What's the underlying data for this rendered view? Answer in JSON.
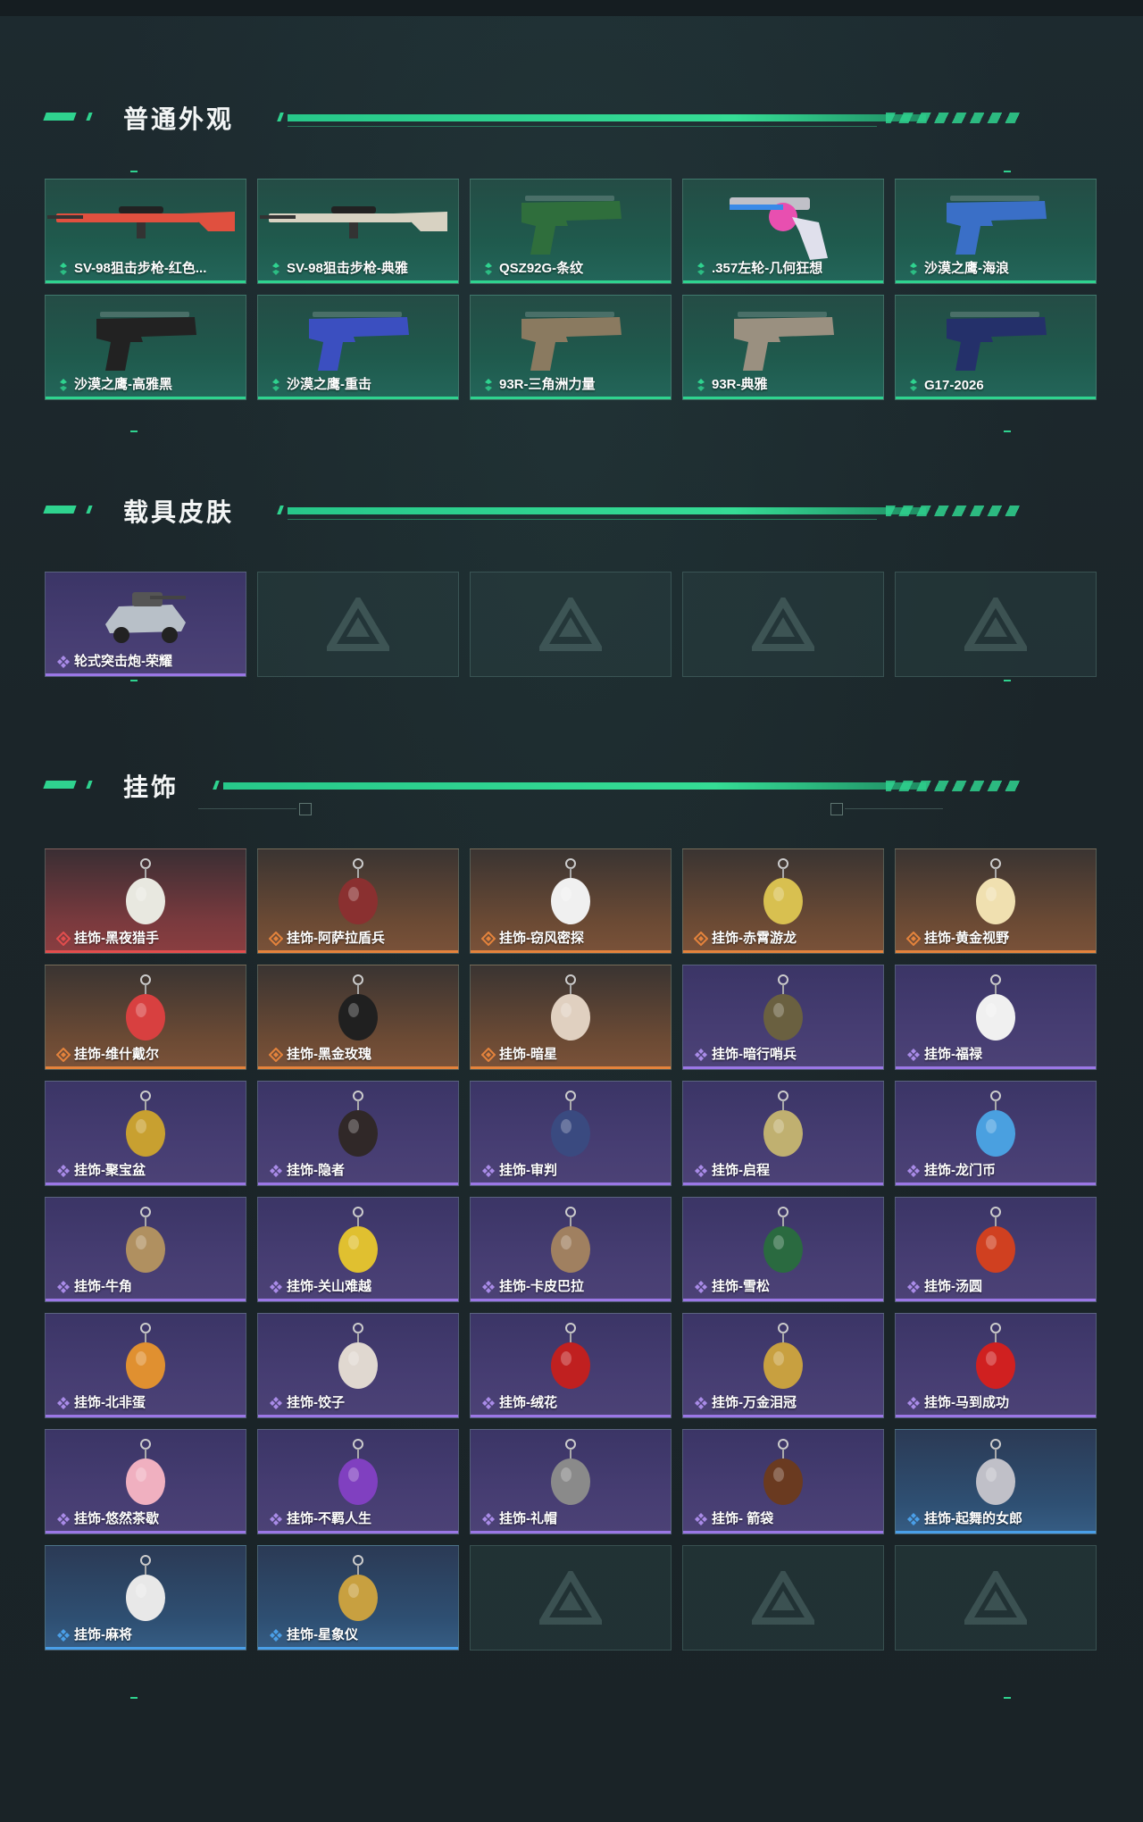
{
  "sections": {
    "skins": {
      "title": "普通外观",
      "items": [
        {
          "label": "SV-98狙击步枪-红色...",
          "rarity": "green",
          "icon": "sniper-rifle-icon",
          "color": "#e0503f"
        },
        {
          "label": "SV-98狙击步枪-典雅",
          "rarity": "green",
          "icon": "sniper-rifle-icon",
          "color": "#d8d2c2"
        },
        {
          "label": "QSZ92G-条纹",
          "rarity": "green",
          "icon": "pistol-icon",
          "color": "#2f6e3c"
        },
        {
          "label": ".357左轮-几何狂想",
          "rarity": "green",
          "icon": "revolver-icon",
          "color": "#e84fb0"
        },
        {
          "label": "沙漠之鹰-海浪",
          "rarity": "green",
          "icon": "pistol-icon",
          "color": "#3a6fc7"
        },
        {
          "label": "沙漠之鹰-高雅黑",
          "rarity": "green",
          "icon": "pistol-icon",
          "color": "#222222"
        },
        {
          "label": "沙漠之鹰-重击",
          "rarity": "green",
          "icon": "pistol-icon",
          "color": "#3b4fc0"
        },
        {
          "label": "93R-三角洲力量",
          "rarity": "green",
          "icon": "pistol-icon",
          "color": "#8a7a60"
        },
        {
          "label": "93R-典雅",
          "rarity": "green",
          "icon": "pistol-icon",
          "color": "#9a9080"
        },
        {
          "label": "G17-2026",
          "rarity": "green",
          "icon": "pistol-icon",
          "color": "#24306a"
        }
      ]
    },
    "vehicles": {
      "title": "载具皮肤",
      "items": [
        {
          "label": "轮式突击炮-荣耀",
          "rarity": "purple",
          "icon": "vehicle-icon",
          "color": "#b8c0c8"
        }
      ]
    },
    "charms": {
      "title": "挂饰",
      "items": [
        {
          "label": "挂饰-黑夜猎手",
          "rarity": "red",
          "icon": "charm-icon",
          "color": "#e8e8e0"
        },
        {
          "label": "挂饰-阿萨拉盾兵",
          "rarity": "orange",
          "icon": "charm-icon",
          "color": "#8a3030"
        },
        {
          "label": "挂饰-窃风密探",
          "rarity": "orange",
          "icon": "charm-icon",
          "color": "#f0f0f0"
        },
        {
          "label": "挂饰-赤霄游龙",
          "rarity": "orange",
          "icon": "charm-icon",
          "color": "#d8c050"
        },
        {
          "label": "挂饰-黄金视野",
          "rarity": "orange",
          "icon": "charm-icon",
          "color": "#f0e0b0"
        },
        {
          "label": "挂饰-维什戴尔",
          "rarity": "orange",
          "icon": "charm-icon",
          "color": "#d84040"
        },
        {
          "label": "挂饰-黑金玫瑰",
          "rarity": "orange",
          "icon": "charm-icon",
          "color": "#202020"
        },
        {
          "label": "挂饰-暗星",
          "rarity": "orange",
          "icon": "charm-icon",
          "color": "#e0d0c0"
        },
        {
          "label": "挂饰-暗行哨兵",
          "rarity": "purple",
          "icon": "charm-icon",
          "color": "#6a6040"
        },
        {
          "label": "挂饰-福禄",
          "rarity": "purple",
          "icon": "charm-icon",
          "color": "#f0f0f0"
        },
        {
          "label": "挂饰-聚宝盆",
          "rarity": "purple",
          "icon": "charm-icon",
          "color": "#c8a030"
        },
        {
          "label": "挂饰-隐者",
          "rarity": "purple",
          "icon": "charm-icon",
          "color": "#302828"
        },
        {
          "label": "挂饰-审判",
          "rarity": "purple",
          "icon": "charm-icon",
          "color": "#3a4a80"
        },
        {
          "label": "挂饰-启程",
          "rarity": "purple",
          "icon": "charm-icon",
          "color": "#c0b070"
        },
        {
          "label": "挂饰-龙门币",
          "rarity": "purple",
          "icon": "charm-icon",
          "color": "#4aa0e0"
        },
        {
          "label": "挂饰-牛角",
          "rarity": "purple",
          "icon": "charm-icon",
          "color": "#b09060"
        },
        {
          "label": "挂饰-关山难越",
          "rarity": "purple",
          "icon": "charm-icon",
          "color": "#e0c030"
        },
        {
          "label": "挂饰-卡皮巴拉",
          "rarity": "purple",
          "icon": "charm-icon",
          "color": "#a08060"
        },
        {
          "label": "挂饰-雪松",
          "rarity": "purple",
          "icon": "charm-icon",
          "color": "#2a6a40"
        },
        {
          "label": "挂饰-汤圆",
          "rarity": "purple",
          "icon": "charm-icon",
          "color": "#d04020"
        },
        {
          "label": "挂饰-北非蛋",
          "rarity": "purple",
          "icon": "charm-icon",
          "color": "#e09030"
        },
        {
          "label": "挂饰-饺子",
          "rarity": "purple",
          "icon": "charm-icon",
          "color": "#e0d8d0"
        },
        {
          "label": "挂饰-绒花",
          "rarity": "purple",
          "icon": "charm-icon",
          "color": "#c02020"
        },
        {
          "label": "挂饰-万金泪冠",
          "rarity": "purple",
          "icon": "charm-icon",
          "color": "#c8a040"
        },
        {
          "label": "挂饰-马到成功",
          "rarity": "purple",
          "icon": "charm-icon",
          "color": "#d02020"
        },
        {
          "label": "挂饰-悠然茶歇",
          "rarity": "purple",
          "icon": "charm-icon",
          "color": "#f0b0c0"
        },
        {
          "label": "挂饰-不羁人生",
          "rarity": "purple",
          "icon": "charm-icon",
          "color": "#8040c0"
        },
        {
          "label": "挂饰-礼帽",
          "rarity": "purple",
          "icon": "charm-icon",
          "color": "#8a8a8a"
        },
        {
          "label": "挂饰- 箭袋",
          "rarity": "purple",
          "icon": "charm-icon",
          "color": "#6a3a20"
        },
        {
          "label": "挂饰-起舞的女郎",
          "rarity": "blue",
          "icon": "charm-icon",
          "color": "#c0c0c8"
        },
        {
          "label": "挂饰-麻将",
          "rarity": "blue",
          "icon": "charm-icon",
          "color": "#e8e8e8"
        },
        {
          "label": "挂饰-星象仪",
          "rarity": "blue",
          "icon": "charm-icon",
          "color": "#c8a040"
        }
      ]
    }
  }
}
